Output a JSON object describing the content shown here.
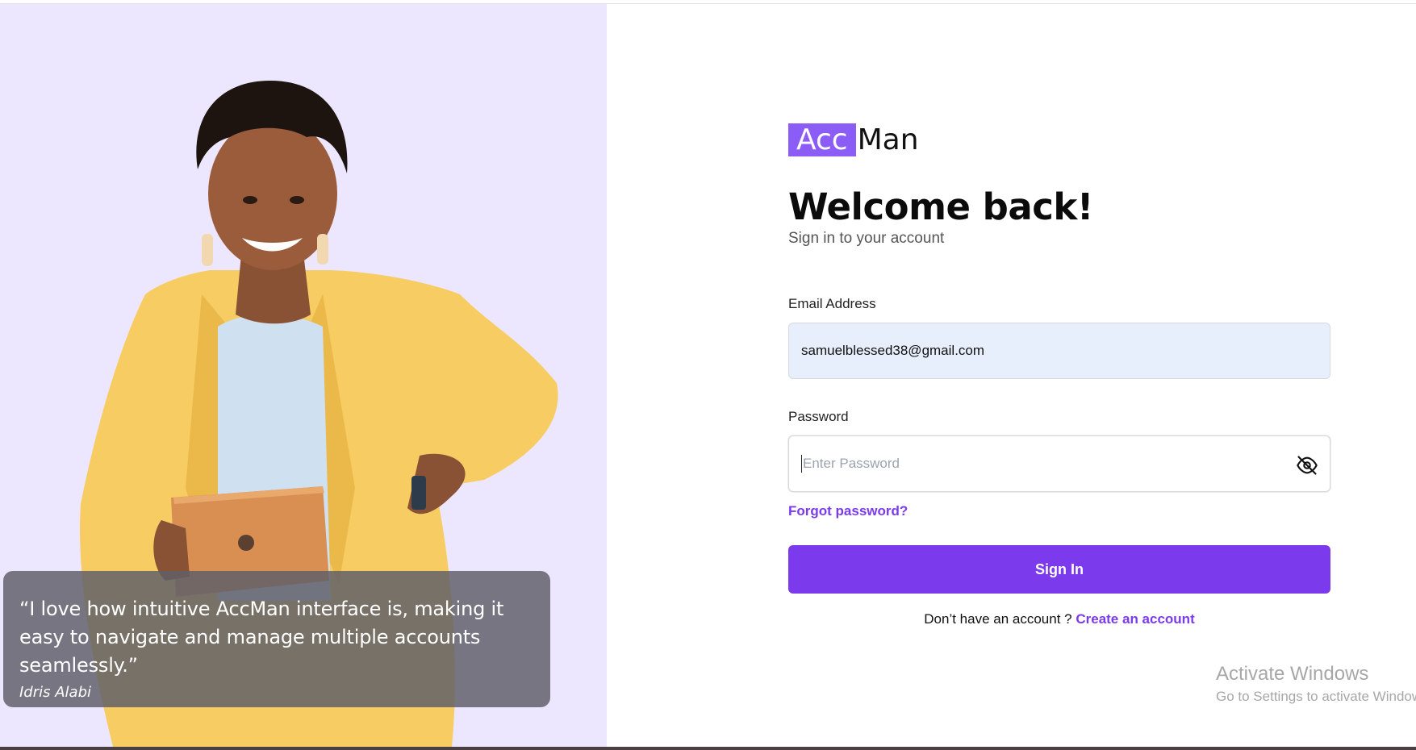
{
  "testimonial": {
    "quote": "“I love how intuitive AccMan interface is, making it easy to navigate and manage multiple accounts seamlessly.”",
    "author": "Idris Alabi"
  },
  "brand": {
    "logo_acc": "Acc",
    "logo_man": "Man",
    "accent": "#8b5cf6"
  },
  "form": {
    "title": "Welcome back!",
    "subtitle": "Sign in to your account",
    "email_label": "Email Address",
    "email_value": "samuelblessed38@gmail.com",
    "password_label": "Password",
    "password_placeholder": "Enter Password",
    "password_icon": "eye-off-icon",
    "forgot_label": "Forgot password?",
    "signin_label": "Sign In",
    "signup_prompt": "Don’t have an account ? ",
    "signup_link": "Create an account",
    "primary_color": "#7c3aed"
  },
  "watermark": {
    "title": "Activate Windows",
    "subtitle": "Go to Settings to activate Windows."
  }
}
